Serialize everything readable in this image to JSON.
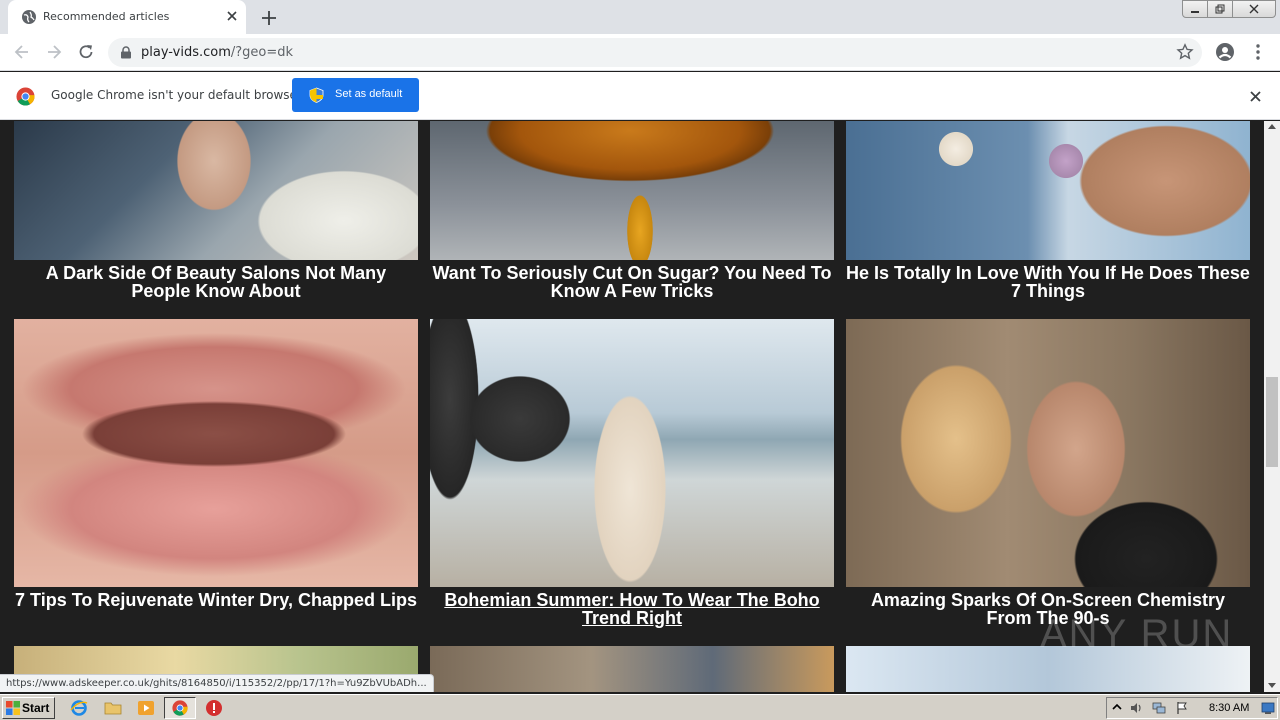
{
  "browser": {
    "tab_title": "Recommended articles",
    "url_host": "play-vids.com",
    "url_rest": "/?geo=dk"
  },
  "infobar": {
    "message": "Google Chrome isn't your default browser",
    "button_label": "Set as default"
  },
  "articles": [
    {
      "caption": "A Dark Side Of Beauty Salons Not Many People Know About",
      "image": "salon"
    },
    {
      "caption": "Want To Seriously Cut On Sugar? You Need To Know A Few Tricks",
      "image": "honey"
    },
    {
      "caption": "He Is Totally In Love With You If He Does These 7 Things",
      "image": "icecream"
    },
    {
      "caption": "7 Tips To Rejuvenate Winter Dry, Chapped Lips",
      "image": "lips"
    },
    {
      "caption": "Bohemian Summer: How To Wear The Boho Trend Right",
      "image": "beach",
      "hovered": true
    },
    {
      "caption": "Amazing Sparks Of On-Screen Chemistry From The 90-s",
      "image": "kiss"
    }
  ],
  "status_url": "https://www.adskeeper.co.uk/ghits/8164850/i/115352/2/pp/17/1?h=Yu9ZbVUbADh...",
  "watermark": "ANY RUN",
  "taskbar": {
    "start_label": "Start",
    "clock": "8:30 AM"
  },
  "colors": {
    "page_bg": "#1f1f1f",
    "accent_button": "#1a73e8",
    "caption_text": "#ffffff"
  }
}
